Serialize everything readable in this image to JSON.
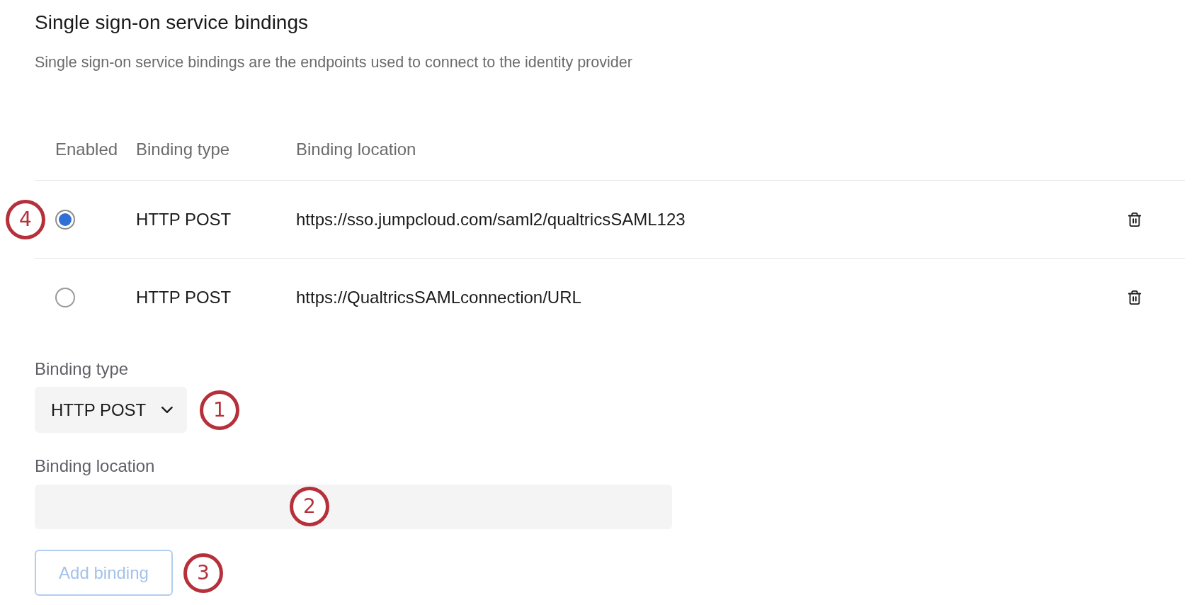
{
  "section": {
    "title": "Single sign-on service bindings",
    "description": "Single sign-on service bindings are the endpoints used to connect to the identity provider"
  },
  "table": {
    "columns": [
      "Enabled",
      "Binding type",
      "Binding location"
    ],
    "rows": [
      {
        "selected": true,
        "binding_type": "HTTP POST",
        "binding_location": "https://sso.jumpcloud.com/saml2/qualtricsSAML123",
        "callout": "4"
      },
      {
        "selected": false,
        "binding_type": "HTTP POST",
        "binding_location": "https://QualtricsSAMLconnection/URL"
      }
    ]
  },
  "form": {
    "binding_type": {
      "label": "Binding type",
      "value": "HTTP POST",
      "callout": "1"
    },
    "binding_location": {
      "label": "Binding location",
      "callout": "2"
    },
    "add_button": {
      "label": "Add binding",
      "disabled": true,
      "callout": "3"
    }
  }
}
